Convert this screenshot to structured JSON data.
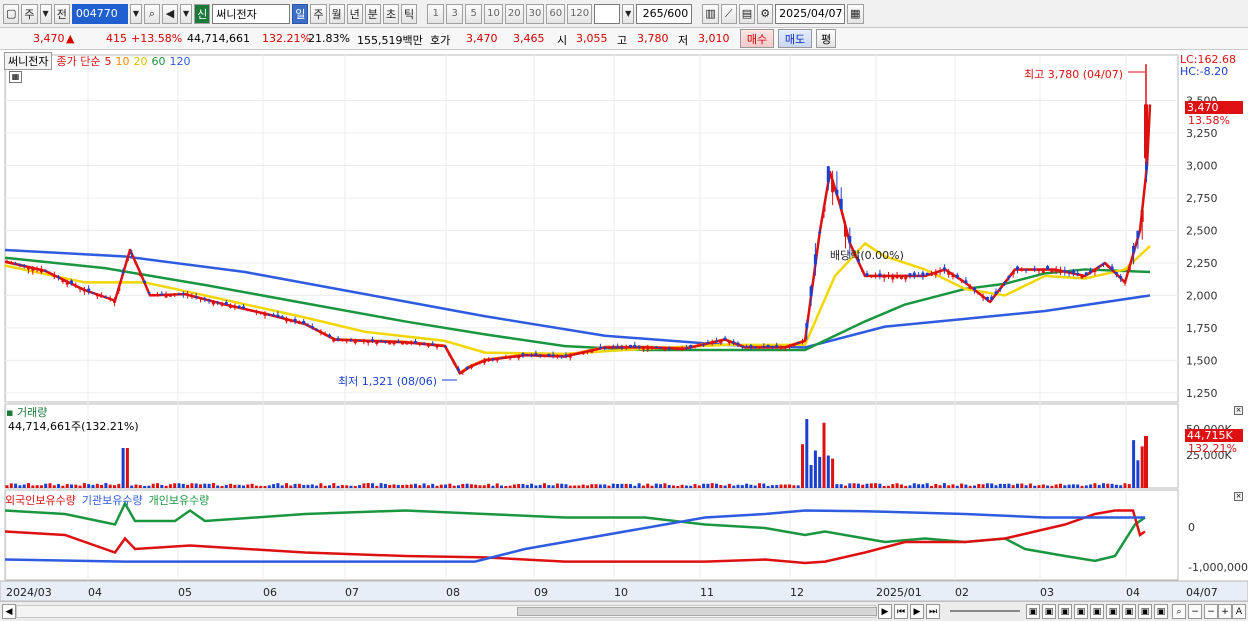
{
  "toolbar": {
    "market": "주",
    "prev_label": "전",
    "code": "004770",
    "new_badge": "신",
    "stock_name": "써니전자",
    "periods": [
      "일",
      "주",
      "월",
      "년",
      "분",
      "초",
      "틱"
    ],
    "selected_period": "일",
    "intervals": [
      "1",
      "3",
      "5",
      "10",
      "20",
      "30",
      "60",
      "120"
    ],
    "count_display": "265/600",
    "date": "2025/04/07"
  },
  "quote": {
    "price": "3,470",
    "change": "415",
    "change_pct": "+13.58%",
    "volume": "44,714,661",
    "volume_ratio": "132.21%",
    "turnover": "21.83%",
    "amount": "155,519백만",
    "bid_label": "호가",
    "ask": "3,470",
    "bid": "3,465",
    "open_label": "시",
    "open": "3,055",
    "high_label": "고",
    "high": "3,780",
    "low_label": "저",
    "low": "3,010",
    "buy_label": "매수",
    "sell_label": "매도",
    "eval_label": "평"
  },
  "legend": {
    "name": "써니전자",
    "close_label": "종가 단순",
    "ma5": "5",
    "ma10": "10",
    "ma20": "20",
    "ma60": "60",
    "ma120": "120",
    "lc": "LC:162.68",
    "hc": "HC:-8.20",
    "last_price": "3,470",
    "last_pct": "13.58%",
    "high_annot": "최고 3,780 (04/07)",
    "low_annot": "최저 1,321 (08/06)",
    "dividend_annot": "배당락(0.00%)"
  },
  "volume_panel": {
    "title": "거래량",
    "value": "44,714,661주(132.21%)",
    "last": "44,715K",
    "last_pct": "132.21%"
  },
  "holdings_panel": {
    "foreign": "외국인보유수량",
    "inst": "기관보유수량",
    "indiv": "개인보유수량"
  },
  "colors": {
    "ma5": "#dd1111",
    "ma10": "#ff8c00",
    "ma20": "#f2d600",
    "ma60": "#1a9640",
    "ma120": "#2e5be0",
    "up": "#dd1111",
    "down": "#1a3fcf"
  },
  "chart_data": {
    "type": "candlestick",
    "y_ticks": [
      "3,500",
      "3,250",
      "3,000",
      "2,750",
      "2,500",
      "2,250",
      "2,000",
      "1,750",
      "1,500",
      "1,250"
    ],
    "price_range": [
      1180,
      3850
    ],
    "x_labels": [
      "2024/03",
      "04",
      "05",
      "06",
      "07",
      "08",
      "09",
      "10",
      "11",
      "12",
      "2025/01",
      "02",
      "03",
      "04",
      "04/07"
    ],
    "volume_ticks": [
      "50,000K",
      "25,000K"
    ],
    "holdings_ticks": [
      "0",
      "-1,000,000"
    ],
    "close_path": [
      [
        0,
        2260
      ],
      [
        40,
        2190
      ],
      [
        80,
        2040
      ],
      [
        110,
        1960
      ],
      [
        125,
        2350
      ],
      [
        135,
        2180
      ],
      [
        145,
        2000
      ],
      [
        180,
        2010
      ],
      [
        220,
        1930
      ],
      [
        260,
        1860
      ],
      [
        300,
        1780
      ],
      [
        330,
        1660
      ],
      [
        360,
        1650
      ],
      [
        400,
        1640
      ],
      [
        440,
        1610
      ],
      [
        455,
        1400
      ],
      [
        465,
        1450
      ],
      [
        480,
        1500
      ],
      [
        520,
        1540
      ],
      [
        560,
        1530
      ],
      [
        600,
        1600
      ],
      [
        640,
        1600
      ],
      [
        680,
        1590
      ],
      [
        720,
        1660
      ],
      [
        740,
        1600
      ],
      [
        780,
        1600
      ],
      [
        800,
        1650
      ],
      [
        815,
        2500
      ],
      [
        825,
        2950
      ],
      [
        835,
        2700
      ],
      [
        845,
        2400
      ],
      [
        860,
        2150
      ],
      [
        880,
        2150
      ],
      [
        920,
        2150
      ],
      [
        940,
        2200
      ],
      [
        960,
        2100
      ],
      [
        985,
        1950
      ],
      [
        1010,
        2200
      ],
      [
        1050,
        2200
      ],
      [
        1080,
        2150
      ],
      [
        1100,
        2250
      ],
      [
        1120,
        2100
      ],
      [
        1135,
        2500
      ],
      [
        1142,
        3000
      ],
      [
        1145,
        3470
      ]
    ],
    "ma20_path": [
      [
        0,
        2230
      ],
      [
        80,
        2100
      ],
      [
        140,
        2100
      ],
      [
        200,
        2000
      ],
      [
        300,
        1830
      ],
      [
        360,
        1720
      ],
      [
        440,
        1650
      ],
      [
        480,
        1560
      ],
      [
        560,
        1550
      ],
      [
        640,
        1590
      ],
      [
        720,
        1620
      ],
      [
        800,
        1620
      ],
      [
        830,
        2150
      ],
      [
        860,
        2400
      ],
      [
        880,
        2300
      ],
      [
        920,
        2200
      ],
      [
        960,
        2050
      ],
      [
        1000,
        2000
      ],
      [
        1040,
        2150
      ],
      [
        1080,
        2130
      ],
      [
        1120,
        2200
      ],
      [
        1145,
        2380
      ]
    ],
    "ma60_path": [
      [
        0,
        2290
      ],
      [
        100,
        2210
      ],
      [
        200,
        2080
      ],
      [
        300,
        1940
      ],
      [
        400,
        1800
      ],
      [
        480,
        1700
      ],
      [
        560,
        1610
      ],
      [
        640,
        1580
      ],
      [
        720,
        1580
      ],
      [
        800,
        1580
      ],
      [
        860,
        1800
      ],
      [
        900,
        1930
      ],
      [
        960,
        2050
      ],
      [
        1000,
        2090
      ],
      [
        1040,
        2170
      ],
      [
        1080,
        2200
      ],
      [
        1145,
        2180
      ]
    ],
    "ma120_path": [
      [
        0,
        2350
      ],
      [
        120,
        2300
      ],
      [
        240,
        2180
      ],
      [
        360,
        2010
      ],
      [
        480,
        1840
      ],
      [
        600,
        1690
      ],
      [
        720,
        1620
      ],
      [
        800,
        1600
      ],
      [
        880,
        1760
      ],
      [
        960,
        1820
      ],
      [
        1040,
        1880
      ],
      [
        1145,
        2000
      ]
    ]
  }
}
